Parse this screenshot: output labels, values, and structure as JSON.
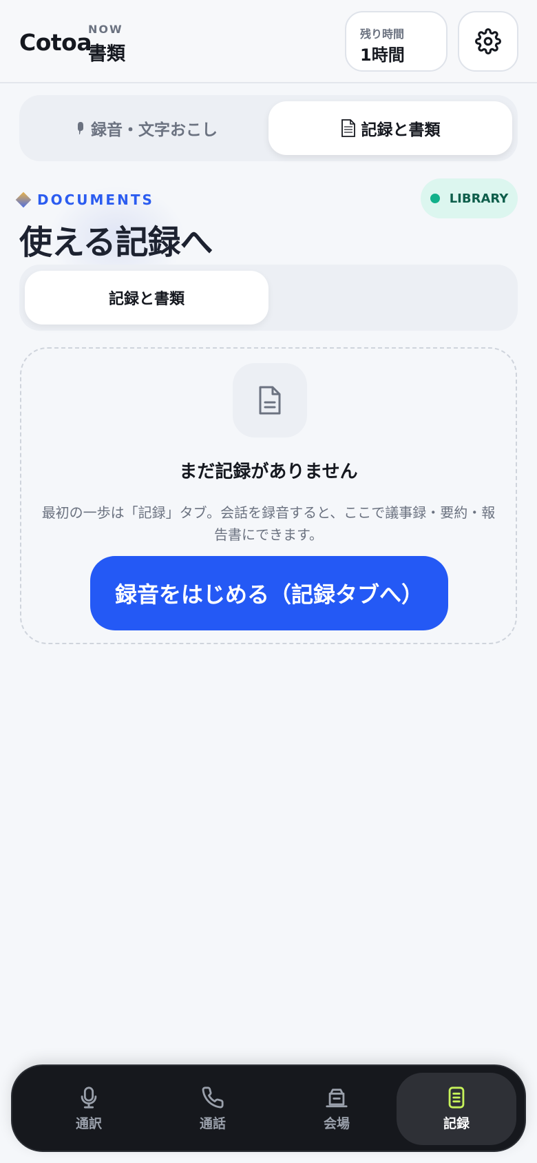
{
  "header": {
    "brand": "Cotoa",
    "now_label": "NOW",
    "now_value": "書類",
    "remaining_label": "残り時間",
    "remaining_value": "1時間",
    "settings_icon": "gear-icon"
  },
  "mode_tabs": [
    {
      "icon": "mic-icon",
      "label": "録音・文字おこし",
      "active": false
    },
    {
      "icon": "document-icon",
      "label": "記録と書類",
      "active": true
    }
  ],
  "section": {
    "eyebrow": "DOCUMENTS",
    "badge": "LIBRARY",
    "title": "使える記録へ"
  },
  "sub_tabs": [
    {
      "label": "記録と書類",
      "active": true
    }
  ],
  "empty_state": {
    "icon": "document-icon",
    "title": "まだ記録がありません",
    "description": "最初の一歩は「記録」タブ。会話を録音すると、ここで議事録・要約・報告書にできます。",
    "cta": "録音をはじめる（記録タブへ）"
  },
  "bottom_nav": [
    {
      "icon": "mic-icon",
      "label": "通訳",
      "active": false
    },
    {
      "icon": "phone-icon",
      "label": "通話",
      "active": false
    },
    {
      "icon": "venue-icon",
      "label": "会場",
      "active": false
    },
    {
      "icon": "notes-icon",
      "label": "記録",
      "active": true
    }
  ],
  "colors": {
    "accent": "#2459f5",
    "nav_active_icon": "#c6f25a",
    "library_dot": "#12b08a"
  }
}
